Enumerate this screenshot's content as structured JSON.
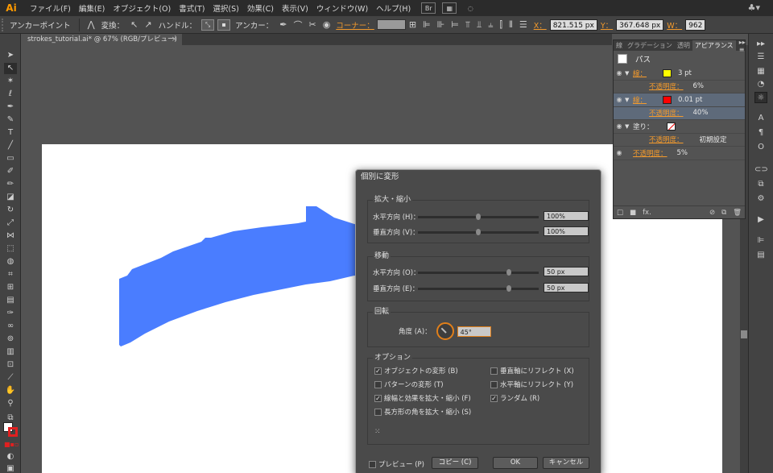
{
  "app": {
    "logo": "Ai",
    "accent": "#ff9a00"
  },
  "menu": [
    "ファイル(F)",
    "編集(E)",
    "オブジェクト(O)",
    "書式(T)",
    "選択(S)",
    "効果(C)",
    "表示(V)",
    "ウィンドウ(W)",
    "ヘルプ(H)"
  ],
  "menu_icons": {
    "br": "Br"
  },
  "control": {
    "mode": "アンカーポイント",
    "convert": "変換：",
    "handle": "ハンドル：",
    "anchor": "アンカー：",
    "corner": "コーナー：",
    "x_label": "X：",
    "x_value": "821.515 px",
    "y_label": "Y：",
    "y_value": "367.648 px",
    "w_label": "W：",
    "w_value": "962"
  },
  "document": {
    "tab": "strokes_tutorial.ai* @ 67% (RGB/プレビュー)",
    "close": "×"
  },
  "shape": {
    "fill": "#4a7dff"
  },
  "panel": {
    "tabs": [
      "線",
      "グラデーション",
      "透明",
      "アピアランス"
    ],
    "active_tab": "アピアランス",
    "menu": "▸▸ ≡",
    "title": "パス",
    "rows": [
      {
        "type": "stroke",
        "name": "線：",
        "color": "#ffff00",
        "value": "3 pt"
      },
      {
        "type": "opacity",
        "name": "不透明度：",
        "value": "6%"
      },
      {
        "type": "stroke",
        "name": "線：",
        "color": "#ff0000",
        "value": "0.01 pt",
        "selected": true
      },
      {
        "type": "opacity",
        "name": "不透明度：",
        "value": "40%",
        "selected": true
      },
      {
        "type": "fill",
        "name": "塗り："
      },
      {
        "type": "opacity",
        "name": "不透明度：",
        "value": "初期設定"
      },
      {
        "type": "opacity-top",
        "name": "不透明度：",
        "value": "5%"
      }
    ],
    "footer": [
      "□",
      "■",
      "fx.",
      "⊘",
      "⧉",
      "🗑"
    ]
  },
  "dialog": {
    "title": "個別に変形",
    "scale": {
      "title": "拡大・縮小",
      "h_label": "水平方向 (H)：",
      "h_value": "100%",
      "h_pos": 0.5,
      "v_label": "垂直方向 (V)：",
      "v_value": "100%",
      "v_pos": 0.5
    },
    "move": {
      "title": "移動",
      "h_label": "水平方向 (O)：",
      "h_value": "50 px",
      "h_pos": 0.75,
      "v_label": "垂直方向 (E)：",
      "v_value": "50 px",
      "v_pos": 0.75
    },
    "rotate": {
      "title": "回転",
      "angle_label": "角度 (A)：",
      "angle_value": "45°"
    },
    "options": {
      "title": "オプション",
      "items": [
        {
          "label": "オブジェクトの変形 (B)",
          "checked": true
        },
        {
          "label": "パターンの変形 (T)",
          "checked": false
        },
        {
          "label": "線幅と効果を拡大・縮小 (F)",
          "checked": true
        },
        {
          "label": "長方形の角を拡大・縮小 (S)",
          "checked": false
        },
        {
          "label": "垂直軸にリフレクト (X)",
          "checked": false
        },
        {
          "label": "水平軸にリフレクト (Y)",
          "checked": false
        },
        {
          "label": "ランダム (R)",
          "checked": true
        }
      ]
    },
    "preview": "プレビュー (P)",
    "copy": "コピー (C)",
    "ok": "OK",
    "cancel": "キャンセル"
  }
}
